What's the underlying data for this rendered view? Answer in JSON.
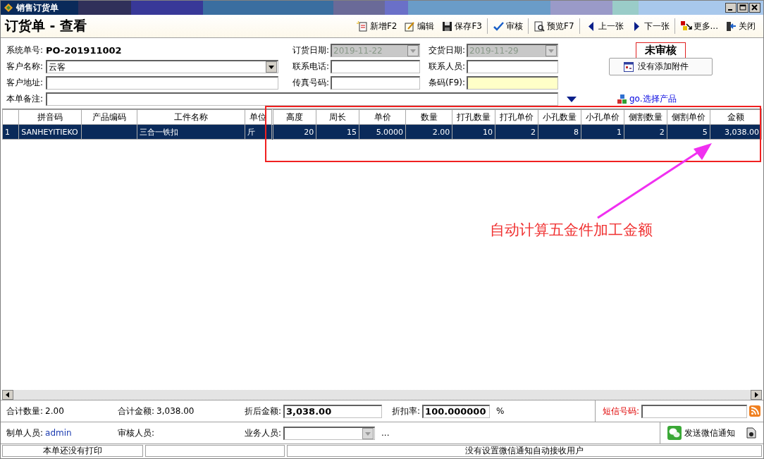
{
  "window": {
    "title": "销售订货单"
  },
  "header": {
    "title": "订货单 - 查看"
  },
  "toolbar": [
    {
      "label": "新增F2"
    },
    {
      "label": "编辑"
    },
    {
      "label": "保存F3"
    },
    {
      "label": "审核"
    },
    {
      "label": "预览F7"
    },
    {
      "label": "上一张"
    },
    {
      "label": "下一张"
    },
    {
      "label": "更多..."
    },
    {
      "label": "关闭"
    }
  ],
  "form": {
    "order_no": {
      "label": "系统单号:",
      "value": "PO-201911002"
    },
    "order_date": {
      "label": "订货日期:",
      "value": "2019-11-22",
      "disabled": true
    },
    "delivery_date": {
      "label": "交货日期:",
      "value": "2019-11-29",
      "disabled": true
    },
    "status": "未审核",
    "customer": {
      "label": "客户名称:",
      "value": "云客"
    },
    "phone": {
      "label": "联系电话:"
    },
    "contact": {
      "label": "联系人员:"
    },
    "attachment_button": "没有添加附件",
    "address": {
      "label": "客户地址:"
    },
    "fax": {
      "label": "传真号码:"
    },
    "barcode": {
      "label": "条码(F9):",
      "highlighted": true
    },
    "remark": {
      "label": "本单备注:"
    },
    "product_link": "go.选择产品"
  },
  "table": {
    "columns": [
      {
        "label": "拼音码"
      },
      {
        "label": "产品编码"
      },
      {
        "label": "工件名称"
      },
      {
        "label": "单位"
      },
      {
        "label": "高度"
      },
      {
        "label": "周长"
      },
      {
        "label": "单价"
      },
      {
        "label": "数量"
      },
      {
        "label": "打孔数量"
      },
      {
        "label": "打孔单价"
      },
      {
        "label": "小孔数量"
      },
      {
        "label": "小孔单价"
      },
      {
        "label": "侧割数量"
      },
      {
        "label": "侧割单价"
      },
      {
        "label": "金额"
      }
    ],
    "rows": [
      {
        "number": "1",
        "selected": true,
        "cells": [
          "SANHEYITIEKO",
          "",
          "三合一铁扣",
          "斤",
          "20",
          "15",
          "5.0000",
          "2.00",
          "10",
          "2",
          "8",
          "1",
          "2",
          "5",
          "3,038.00"
        ]
      }
    ]
  },
  "annotation": {
    "text": "自动计算五金件加工金额"
  },
  "summary": {
    "total_qty": {
      "label": "合计数量:",
      "value": "2.00"
    },
    "total_amount": {
      "label": "合计金额:",
      "value": "3,038.00"
    },
    "discounted": {
      "label": "折后金额:",
      "value": "3,038.00"
    },
    "discount_rate": {
      "label": "折扣率:",
      "value": "100.000000",
      "unit": "%"
    },
    "sms": {
      "label": "短信号码:"
    }
  },
  "people": {
    "creator": {
      "label": "制单人员:",
      "value": "admin"
    },
    "auditor": {
      "label": "审核人员:"
    },
    "salesman": {
      "label": "业务人员:",
      "more": "..."
    },
    "wechat_button": "发送微信通知"
  },
  "status_bar": {
    "print_status": "本单还没有打印",
    "wechat_status": "没有设置微信通知自动接收用户"
  }
}
